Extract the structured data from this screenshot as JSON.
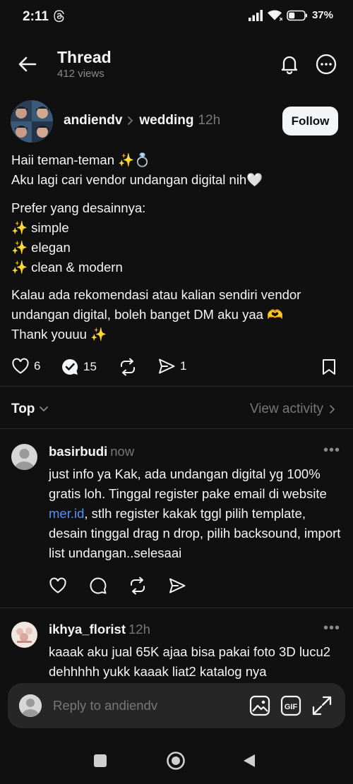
{
  "status_bar": {
    "time": "2:11",
    "battery": "37%"
  },
  "header": {
    "title": "Thread",
    "views": "412 views"
  },
  "post": {
    "author": "andiendv",
    "topic": "wedding",
    "time": "12h",
    "follow_label": "Follow",
    "lines": [
      "Haii teman-teman ✨💍",
      "Aku lagi cari vendor undangan digital nih🤍",
      "Prefer yang desainnya:",
      "✨ simple",
      "✨ elegan",
      "✨ clean & modern",
      "Kalau ada rekomendasi atau kalian sendiri vendor",
      "undangan digital, boleh banget DM aku yaa 🫶",
      "Thank youuu ✨"
    ],
    "likes": "6",
    "replies": "15",
    "shares": "1"
  },
  "sort": {
    "label": "Top",
    "view_activity": "View activity"
  },
  "comments": [
    {
      "username": "basirbudi",
      "time": "now",
      "text_before_link": "just info ya Kak, ada undangan digital yg 100% gratis loh. Tinggal register pake email di website ",
      "link": "mer.id",
      "text_after_link": ", stlh register kakak tggl pilih template, desain tinggal drag n drop, pilih backsound, import list undangan..selesaai"
    },
    {
      "username": "ikhya_florist",
      "time": "12h",
      "text": "kaaak aku jual 65K ajaa bisa pakai foto 3D lucu2 dehhhhh yukk kaaak liat2 katalog nya"
    }
  ],
  "reply_bar": {
    "placeholder": "Reply to andiendv"
  },
  "colors": {
    "background": "#101010",
    "text": "#f3f5f7",
    "muted": "#777777",
    "link": "#5b8ef5",
    "reply_bar": "#262626"
  }
}
